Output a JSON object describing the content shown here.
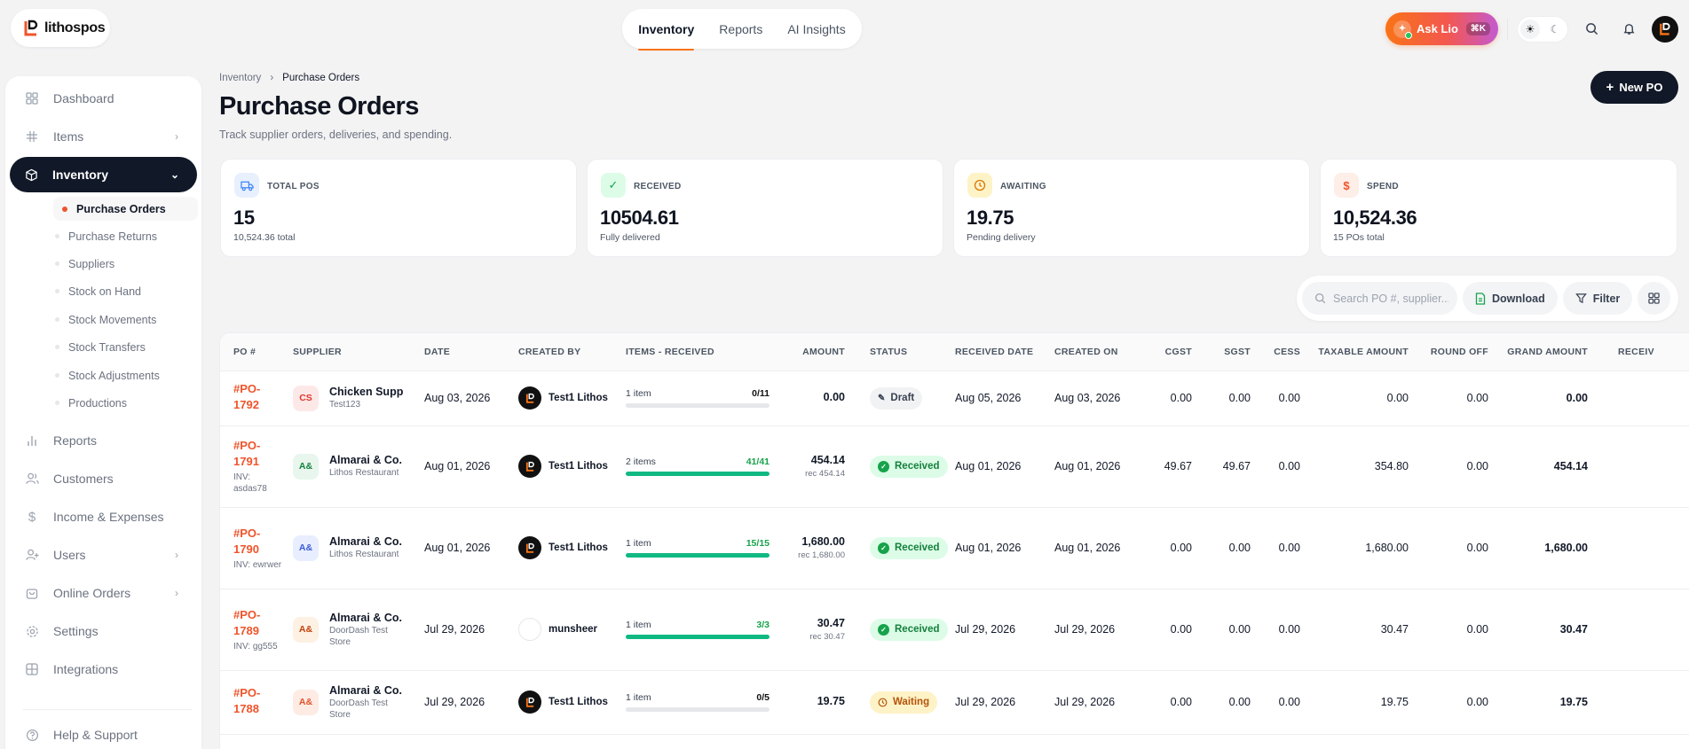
{
  "app": {
    "logo_text": "lithospos"
  },
  "topnav": {
    "items": [
      {
        "label": "Inventory"
      },
      {
        "label": "Reports"
      },
      {
        "label": "AI Insights"
      }
    ]
  },
  "header": {
    "ask_label": "Ask Lio",
    "ask_shortcut": "⌘K"
  },
  "sidebar": {
    "items": [
      {
        "label": "Dashboard",
        "icon": "grid-icon"
      },
      {
        "label": "Items",
        "icon": "items-icon"
      },
      {
        "label": "Inventory",
        "icon": "box-icon"
      },
      {
        "label": "Reports",
        "icon": "bar-chart-icon"
      },
      {
        "label": "Customers",
        "icon": "users-icon"
      },
      {
        "label": "Income & Expenses",
        "icon": "dollar-icon"
      },
      {
        "label": "Users",
        "icon": "user-icon"
      },
      {
        "label": "Online Orders",
        "icon": "bag-icon"
      },
      {
        "label": "Settings",
        "icon": "gear-icon"
      },
      {
        "label": "Integrations",
        "icon": "integrations-icon"
      },
      {
        "label": "Help & Support",
        "icon": "help-icon"
      }
    ],
    "inventory_sub": [
      {
        "label": "Purchase Orders"
      },
      {
        "label": "Purchase Returns"
      },
      {
        "label": "Suppliers"
      },
      {
        "label": "Stock on Hand"
      },
      {
        "label": "Stock Movements"
      },
      {
        "label": "Stock Transfers"
      },
      {
        "label": "Stock Adjustments"
      },
      {
        "label": "Productions"
      }
    ]
  },
  "breadcrumb": {
    "parent": "Inventory",
    "current": "Purchase Orders"
  },
  "page": {
    "title": "Purchase Orders",
    "subtitle": "Track supplier orders, deliveries, and spending.",
    "new_button": "New PO"
  },
  "stats": [
    {
      "label": "TOTAL POS",
      "value": "15",
      "sub": "10,524.36 total",
      "icon": "truck-icon"
    },
    {
      "label": "RECEIVED",
      "value": "10504.61",
      "sub": "Fully delivered",
      "icon": "check-icon"
    },
    {
      "label": "AWAITING",
      "value": "19.75",
      "sub": "Pending delivery",
      "icon": "clock-icon"
    },
    {
      "label": "SPEND",
      "value": "10,524.36",
      "sub": "15 POs total",
      "icon": "dollar-icon"
    }
  ],
  "toolbar": {
    "search_placeholder": "Search PO #, supplier...",
    "download": "Download",
    "filter": "Filter"
  },
  "table": {
    "columns": [
      "PO #",
      "SUPPLIER",
      "DATE",
      "CREATED BY",
      "ITEMS - RECEIVED",
      "AMOUNT",
      "STATUS",
      "RECEIVED DATE",
      "CREATED ON",
      "CGST",
      "SGST",
      "CESS",
      "TAXABLE AMOUNT",
      "ROUND OFF",
      "GRAND AMOUNT",
      "RECEIV"
    ],
    "rows": [
      {
        "po": "#PO-1792",
        "inv": "",
        "badge": "CS",
        "supplier": "Chicken Supp",
        "location": "Test123",
        "date": "Aug 03, 2026",
        "created_by": "Test1 Lithos",
        "items": "1 item",
        "received": "0/11",
        "progress": 0,
        "amount": "0.00",
        "amount_rec": "",
        "status": "Draft",
        "received_date": "Aug 05, 2026",
        "created_on": "Aug 03, 2026",
        "cgst": "0.00",
        "sgst": "0.00",
        "cess": "0.00",
        "taxable": "0.00",
        "round_off": "0.00",
        "grand": "0.00"
      },
      {
        "po": "#PO-1791",
        "inv": "INV: asdas78",
        "badge": "A&",
        "supplier": "Almarai & Co.",
        "location": "Lithos Restaurant",
        "date": "Aug 01, 2026",
        "created_by": "Test1 Lithos",
        "items": "2 items",
        "received": "41/41",
        "progress": 1,
        "amount": "454.14",
        "amount_rec": "rec 454.14",
        "status": "Received",
        "received_date": "Aug 01, 2026",
        "created_on": "Aug 01, 2026",
        "cgst": "49.67",
        "sgst": "49.67",
        "cess": "0.00",
        "taxable": "354.80",
        "round_off": "0.00",
        "grand": "454.14"
      },
      {
        "po": "#PO-1790",
        "inv": "INV: ewrwer",
        "badge": "A&",
        "supplier": "Almarai & Co.",
        "location": "Lithos Restaurant",
        "date": "Aug 01, 2026",
        "created_by": "Test1 Lithos",
        "items": "1 item",
        "received": "15/15",
        "progress": 1,
        "amount": "1,680.00",
        "amount_rec": "rec 1,680.00",
        "status": "Received",
        "received_date": "Aug 01, 2026",
        "created_on": "Aug 01, 2026",
        "cgst": "0.00",
        "sgst": "0.00",
        "cess": "0.00",
        "taxable": "1,680.00",
        "round_off": "0.00",
        "grand": "1,680.00"
      },
      {
        "po": "#PO-1789",
        "inv": "INV: gg555",
        "badge": "A&",
        "supplier": "Almarai & Co.",
        "location": "DoorDash Test Store",
        "date": "Jul 29, 2026",
        "created_by": "munsheer",
        "items": "1 item",
        "received": "3/3",
        "progress": 1,
        "amount": "30.47",
        "amount_rec": "rec 30.47",
        "status": "Received",
        "received_date": "Jul 29, 2026",
        "created_on": "Jul 29, 2026",
        "cgst": "0.00",
        "sgst": "0.00",
        "cess": "0.00",
        "taxable": "30.47",
        "round_off": "0.00",
        "grand": "30.47"
      },
      {
        "po": "#PO-1788",
        "inv": "",
        "badge": "A&",
        "supplier": "Almarai & Co.",
        "location": "DoorDash Test Store",
        "date": "Jul 29, 2026",
        "created_by": "Test1 Lithos",
        "items": "1 item",
        "received": "0/5",
        "progress": 0,
        "amount": "19.75",
        "amount_rec": "",
        "status": "Waiting",
        "received_date": "Jul 29, 2026",
        "created_on": "Jul 29, 2026",
        "cgst": "0.00",
        "sgst": "0.00",
        "cess": "0.00",
        "taxable": "19.75",
        "round_off": "0.00",
        "grand": "19.75"
      }
    ]
  },
  "colors": {
    "accent": "#f0542b",
    "dark": "#111827",
    "success": "#10b981"
  }
}
